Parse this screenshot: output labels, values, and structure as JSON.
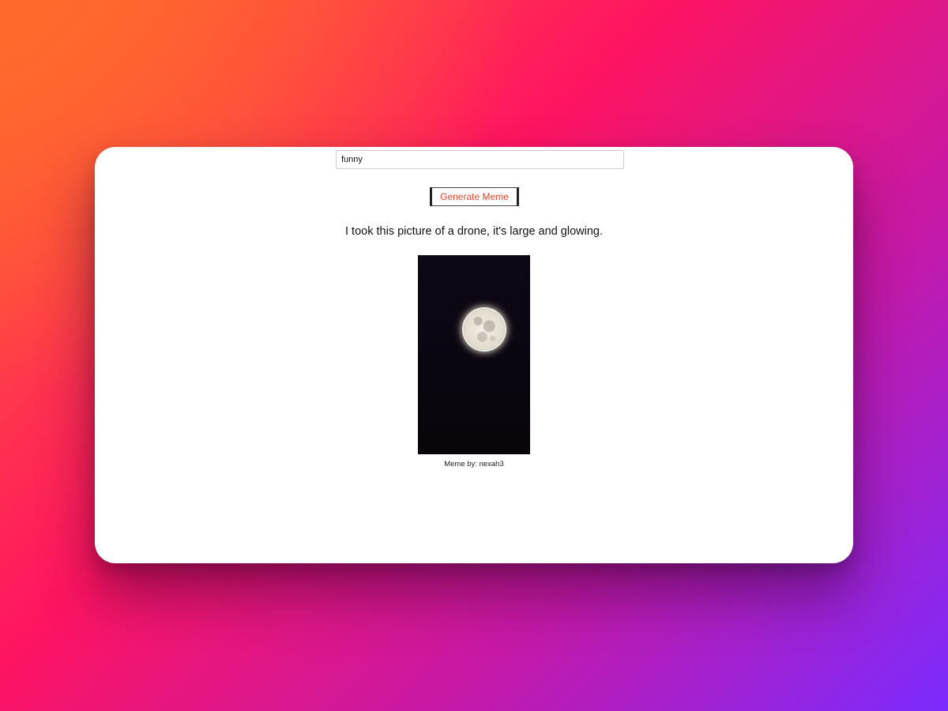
{
  "search": {
    "value": "funny"
  },
  "actions": {
    "generate_label": "Generate Meme"
  },
  "meme": {
    "caption": "I took this picture of a drone, it's large and glowing.",
    "image_alt": "moon-photo",
    "author": "Meme by: nexah3"
  },
  "colors": {
    "button_text": "#e8412c",
    "card_background": "#ffffff",
    "gradient": [
      "#ff6a2c",
      "#ff1461",
      "#c519a8",
      "#7b2bff"
    ]
  }
}
